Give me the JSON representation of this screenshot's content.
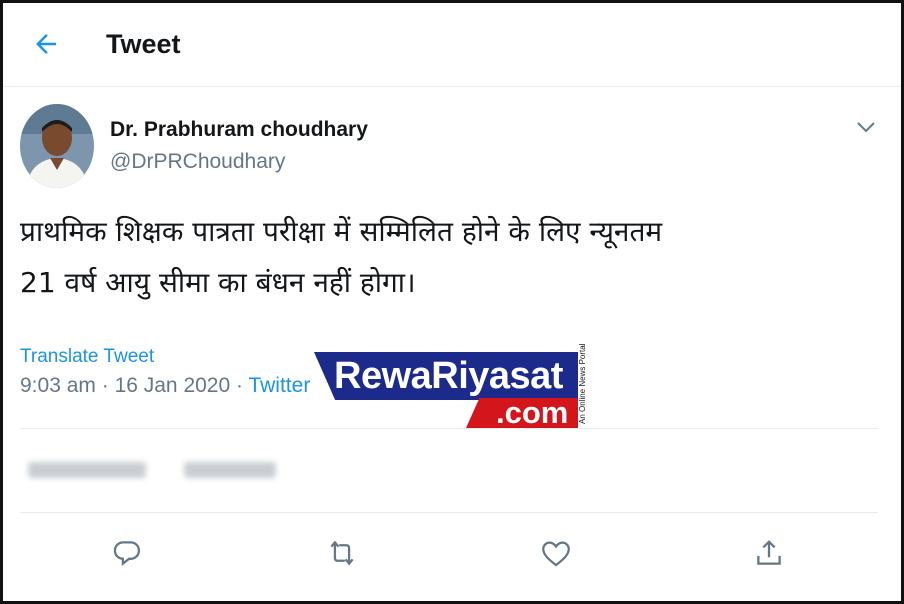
{
  "header": {
    "title": "Tweet",
    "back_icon": "arrow-left-icon"
  },
  "author": {
    "name": "Dr. Prabhuram choudhary",
    "handle": "@DrPRChoudhary"
  },
  "tweet": {
    "text_line1": "प्राथमिक शिक्षक पात्रता परीक्षा में सम्मिलित होने के लिए न्यूनतम",
    "text_line2": "21 वर्ष आयु सीमा का बंधन नहीं होगा।",
    "translate_label": "Translate Tweet",
    "time": "9:03 am",
    "date": "16 Jan 2020",
    "source": "Twitter"
  },
  "stats": {
    "retweets": "",
    "likes": ""
  },
  "actions": [
    "reply-icon",
    "retweet-icon",
    "like-icon",
    "share-icon"
  ],
  "watermark": {
    "line1": "RewaRiyasat",
    "line2": ".com",
    "tagline": "An Online News Portal"
  },
  "colors": {
    "accent": "#1b95e0",
    "text": "#14171a",
    "muted": "#657786",
    "wm_blue": "#1c2a8c",
    "wm_red": "#d4151b"
  }
}
